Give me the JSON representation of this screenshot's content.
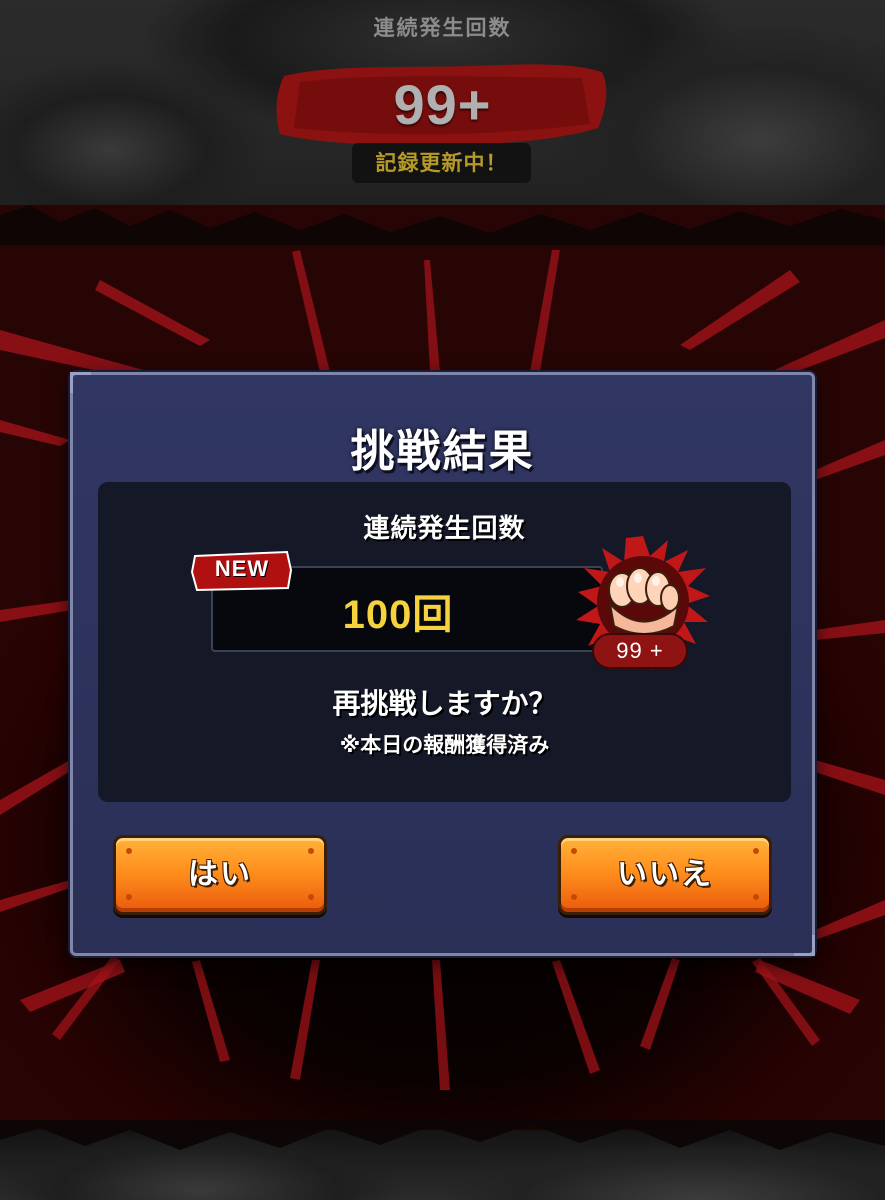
{
  "top": {
    "label": "連続発生回数",
    "count": "99+",
    "record_badge": "記録更新中！"
  },
  "dialog": {
    "title": "挑戦結果",
    "streak_label": "連続発生回数",
    "new_badge": "NEW",
    "value": "100回",
    "fist_count": "99 +",
    "question": "再挑戦しますか？",
    "note": "※本日の報酬獲得済み",
    "yes_label": "はい",
    "no_label": "いいえ"
  },
  "colors": {
    "dialog_bg": "#2e3460",
    "value_text": "#f6d23c",
    "record_text": "#b59a2a",
    "button_orange": "#ff8f1d",
    "accent_red": "#c01818"
  },
  "icons": {
    "fist": "fist-icon",
    "brush": "red-brush-stroke"
  }
}
